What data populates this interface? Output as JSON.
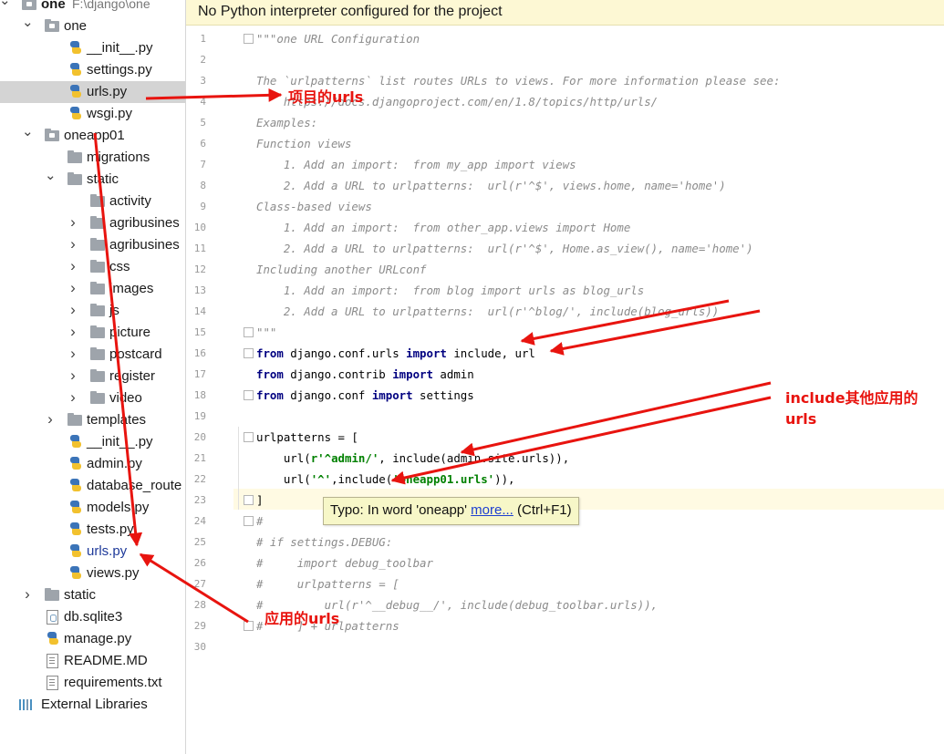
{
  "tree": {
    "rows": [
      {
        "label": "one",
        "hint": "F:\\django\\one",
        "indent": 0,
        "arrow": "expanded",
        "icon": "folder-module",
        "bold": true
      },
      {
        "label": "one",
        "indent": 1,
        "arrow": "expanded",
        "icon": "folder-module"
      },
      {
        "label": "__init__.py",
        "indent": 2,
        "arrow": "",
        "icon": "python-file"
      },
      {
        "label": "settings.py",
        "indent": 2,
        "arrow": "",
        "icon": "python-file"
      },
      {
        "label": "urls.py",
        "indent": 2,
        "arrow": "",
        "icon": "python-file",
        "selected": true
      },
      {
        "label": "wsgi.py",
        "indent": 2,
        "arrow": "",
        "icon": "python-file"
      },
      {
        "label": "oneapp01",
        "indent": 1,
        "arrow": "expanded",
        "icon": "folder-module"
      },
      {
        "label": "migrations",
        "indent": 2,
        "arrow": "",
        "icon": "folder"
      },
      {
        "label": "static",
        "indent": 2,
        "arrow": "expanded",
        "icon": "folder"
      },
      {
        "label": "activity",
        "indent": 3,
        "arrow": "",
        "icon": "folder"
      },
      {
        "label": "agribusines",
        "indent": 3,
        "arrow": "collapsed",
        "icon": "folder"
      },
      {
        "label": "agribusines",
        "indent": 3,
        "arrow": "collapsed",
        "icon": "folder"
      },
      {
        "label": "css",
        "indent": 3,
        "arrow": "collapsed",
        "icon": "folder"
      },
      {
        "label": "images",
        "indent": 3,
        "arrow": "collapsed",
        "icon": "folder"
      },
      {
        "label": "js",
        "indent": 3,
        "arrow": "collapsed",
        "icon": "folder"
      },
      {
        "label": "picture",
        "indent": 3,
        "arrow": "collapsed",
        "icon": "folder"
      },
      {
        "label": "postcard",
        "indent": 3,
        "arrow": "collapsed",
        "icon": "folder"
      },
      {
        "label": "register",
        "indent": 3,
        "arrow": "collapsed",
        "icon": "folder"
      },
      {
        "label": "video",
        "indent": 3,
        "arrow": "collapsed",
        "icon": "folder"
      },
      {
        "label": "templates",
        "indent": 2,
        "arrow": "collapsed",
        "icon": "folder"
      },
      {
        "label": "__init__.py",
        "indent": 2,
        "arrow": "",
        "icon": "python-file"
      },
      {
        "label": "admin.py",
        "indent": 2,
        "arrow": "",
        "icon": "python-file"
      },
      {
        "label": "database_route",
        "indent": 2,
        "arrow": "",
        "icon": "python-file"
      },
      {
        "label": "models.py",
        "indent": 2,
        "arrow": "",
        "icon": "python-file"
      },
      {
        "label": "tests.py",
        "indent": 2,
        "arrow": "",
        "icon": "python-file"
      },
      {
        "label": "urls.py",
        "indent": 2,
        "arrow": "",
        "icon": "python-file",
        "blue": true
      },
      {
        "label": "views.py",
        "indent": 2,
        "arrow": "",
        "icon": "python-file"
      },
      {
        "label": "static",
        "indent": 1,
        "arrow": "collapsed",
        "icon": "folder"
      },
      {
        "label": "db.sqlite3",
        "indent": 1,
        "arrow": "",
        "icon": "database-file"
      },
      {
        "label": "manage.py",
        "indent": 1,
        "arrow": "",
        "icon": "python-file"
      },
      {
        "label": "README.MD",
        "indent": 1,
        "arrow": "",
        "icon": "text-file"
      },
      {
        "label": "requirements.txt",
        "indent": 1,
        "arrow": "",
        "icon": "text-file"
      },
      {
        "label": "External Libraries",
        "indent": 0,
        "arrow": "",
        "icon": "libraries"
      }
    ]
  },
  "editor": {
    "banner": "No Python interpreter configured for the project",
    "lines": [
      [
        [
          "cm",
          "\"\"\"one URL Configuration"
        ]
      ],
      [
        [
          "",
          ""
        ]
      ],
      [
        [
          "cm",
          "The `urlpatterns` list routes URLs to views. For more information please see:"
        ]
      ],
      [
        [
          "cm",
          "    https://docs.djangoproject.com/en/1.8/topics/http/urls/"
        ]
      ],
      [
        [
          "cm",
          "Examples:"
        ]
      ],
      [
        [
          "cm",
          "Function views"
        ]
      ],
      [
        [
          "cm",
          "    1. Add an import:  from my_app import views"
        ]
      ],
      [
        [
          "cm",
          "    2. Add a URL to urlpatterns:  url(r'^$', views.home, name='home')"
        ]
      ],
      [
        [
          "cm",
          "Class-based views"
        ]
      ],
      [
        [
          "cm",
          "    1. Add an import:  from other_app.views import Home"
        ]
      ],
      [
        [
          "cm",
          "    2. Add a URL to urlpatterns:  url(r'^$', Home.as_view(), name='home')"
        ]
      ],
      [
        [
          "cm",
          "Including another URLconf"
        ]
      ],
      [
        [
          "cm",
          "    1. Add an import:  from blog import urls as blog_urls"
        ]
      ],
      [
        [
          "cm",
          "    2. Add a URL to urlpatterns:  url(r'^blog/', include(blog_urls))"
        ]
      ],
      [
        [
          "cm",
          "\"\"\""
        ]
      ],
      [
        [
          "kw",
          "from"
        ],
        [
          "",
          " django.conf.urls "
        ],
        [
          "kw",
          "import"
        ],
        [
          "",
          " include, url"
        ]
      ],
      [
        [
          "kw",
          "from"
        ],
        [
          "",
          " django.contrib "
        ],
        [
          "kw",
          "import"
        ],
        [
          "",
          " admin"
        ]
      ],
      [
        [
          "kw",
          "from"
        ],
        [
          "",
          " django.conf "
        ],
        [
          "kw",
          "import"
        ],
        [
          "",
          " settings"
        ]
      ],
      [
        [
          "",
          ""
        ]
      ],
      [
        [
          "",
          "urlpatterns = ["
        ]
      ],
      [
        [
          "",
          "    url("
        ],
        [
          "st",
          "r'^admin/'"
        ],
        [
          "",
          ", include(admin.site.urls)),"
        ]
      ],
      [
        [
          "",
          "    url("
        ],
        [
          "st",
          "'^'"
        ],
        [
          "",
          ",include("
        ],
        [
          "st",
          "'oneapp01.urls'"
        ],
        [
          "",
          ")),"
        ]
      ],
      [
        [
          "",
          "]"
        ]
      ],
      [
        [
          "cm",
          "#"
        ]
      ],
      [
        [
          "cm",
          "# if settings.DEBUG:"
        ]
      ],
      [
        [
          "cm",
          "#     import debug_toolbar"
        ]
      ],
      [
        [
          "cm",
          "#     urlpatterns = ["
        ]
      ],
      [
        [
          "cm",
          "#         url(r'^__debug__/', include(debug_toolbar.urls)),"
        ]
      ],
      [
        [
          "cm",
          "#     ] + urlpatterns"
        ]
      ],
      [
        [
          "",
          ""
        ]
      ]
    ],
    "line_numbers": [
      "1",
      "2",
      "3",
      "4",
      "5",
      "6",
      "7",
      "8",
      "9",
      "10",
      "11",
      "12",
      "13",
      "14",
      "15",
      "16",
      "17",
      "18",
      "19",
      "20",
      "21",
      "22",
      "23",
      "24",
      "25",
      "26",
      "27",
      "28",
      "29",
      "30"
    ]
  },
  "tooltip": {
    "prefix": "Typo: In word 'oneapp' ",
    "link": "more...",
    "shortcut": " (Ctrl+F1)"
  },
  "annotations": {
    "project_urls": "项目的urls",
    "include_line1": "include其他应用的",
    "include_line2": "urls",
    "app_urls": "应用的urls",
    "color": "#e8140f"
  }
}
